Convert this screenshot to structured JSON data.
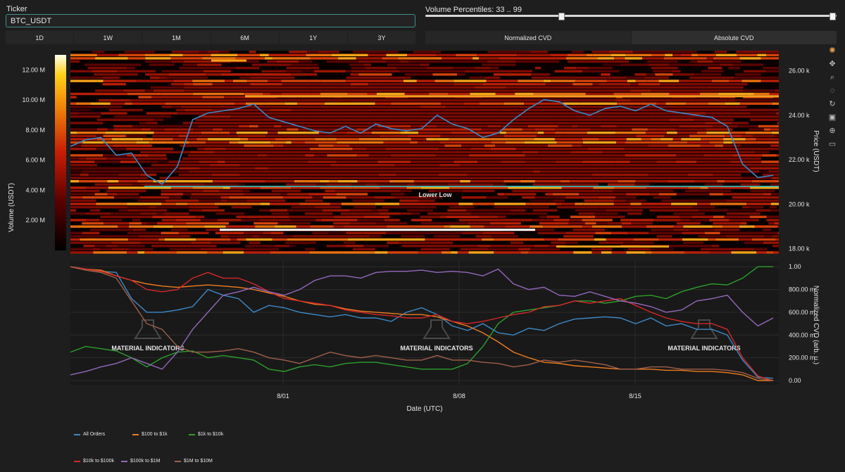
{
  "ticker": {
    "label": "Ticker",
    "value": "BTC_USDT"
  },
  "time_ranges": [
    "1D",
    "1W",
    "1M",
    "6M",
    "1Y",
    "3Y"
  ],
  "volume_percentiles": {
    "label": "Volume Percentiles: 33 .. 99",
    "low": 33,
    "high": 99,
    "min": 0,
    "max": 100
  },
  "cvd_modes": {
    "normalized": "Normalized CVD",
    "absolute": "Absolute CVD"
  },
  "toolbar_icons": [
    "color-wheel-icon",
    "pan-icon",
    "zoom-icon",
    "lasso-icon",
    "rotate-icon",
    "save-icon",
    "crosshair-icon",
    "comment-icon"
  ],
  "watermark": "MATERIAL INDICATORS",
  "chart_data": [
    {
      "type": "heatmap",
      "colorbar": {
        "title": "Volume (USDT)",
        "ticks": [
          "2.00 M",
          "4.00 M",
          "6.00 M",
          "8.00 M",
          "10.00 M",
          "12.00 M"
        ],
        "range": [
          0,
          13000000
        ]
      },
      "ylabel": "Price (USDT)",
      "yticks": [
        "18.00 k",
        "20.00 k",
        "22.00 k",
        "24.00 k",
        "26.00 k"
      ],
      "ylim": [
        17800,
        26900
      ],
      "annotation": {
        "text": "Lower Low",
        "price": 20800,
        "color": "#2fd4d4"
      },
      "series": [
        {
          "name": "Price",
          "color": "#3c89c8",
          "values": [
            22600,
            22900,
            23000,
            22200,
            22300,
            21300,
            20900,
            21700,
            23800,
            24100,
            24200,
            24300,
            24500,
            23900,
            23700,
            23500,
            23300,
            23200,
            23500,
            23200,
            23600,
            23400,
            23300,
            23400,
            24000,
            23600,
            23400,
            23000,
            23200,
            23800,
            24300,
            24700,
            24600,
            24200,
            24000,
            24300,
            24400,
            24200,
            24500,
            24200,
            24100,
            24000,
            23900,
            23500,
            21800,
            21200,
            21300
          ]
        }
      ]
    },
    {
      "type": "line",
      "ylabel": "Normalized CVD (arb. u.)",
      "yticks": [
        "0.00",
        "200.00 m",
        "400.00 m",
        "600.00 m",
        "800.00 m",
        "1.00"
      ],
      "ylim": [
        0,
        1.02
      ],
      "xlabel": "Date (UTC)",
      "xticks": [
        "8/01",
        "8/08",
        "8/15"
      ],
      "series": [
        {
          "name": "All Orders",
          "color": "#3c89c8",
          "values": [
            1.0,
            0.98,
            0.96,
            0.95,
            0.72,
            0.6,
            0.6,
            0.62,
            0.65,
            0.8,
            0.75,
            0.72,
            0.6,
            0.66,
            0.64,
            0.6,
            0.58,
            0.56,
            0.58,
            0.55,
            0.55,
            0.52,
            0.6,
            0.64,
            0.58,
            0.48,
            0.44,
            0.5,
            0.42,
            0.4,
            0.46,
            0.44,
            0.5,
            0.54,
            0.55,
            0.56,
            0.55,
            0.5,
            0.55,
            0.48,
            0.5,
            0.45,
            0.45,
            0.4,
            0.18,
            0.03,
            0.02
          ]
        },
        {
          "name": "$100 to $1k",
          "color": "#ef7d1e",
          "values": [
            1.0,
            0.98,
            0.97,
            0.92,
            0.88,
            0.85,
            0.83,
            0.82,
            0.83,
            0.84,
            0.83,
            0.82,
            0.8,
            0.77,
            0.74,
            0.7,
            0.67,
            0.66,
            0.63,
            0.61,
            0.6,
            0.59,
            0.58,
            0.58,
            0.56,
            0.52,
            0.48,
            0.42,
            0.34,
            0.25,
            0.2,
            0.16,
            0.15,
            0.13,
            0.12,
            0.11,
            0.1,
            0.1,
            0.1,
            0.09,
            0.09,
            0.08,
            0.08,
            0.07,
            0.05,
            0.0,
            0.0
          ]
        },
        {
          "name": "$1k to $10k",
          "color": "#2ca02c",
          "values": [
            0.25,
            0.3,
            0.28,
            0.26,
            0.2,
            0.12,
            0.2,
            0.25,
            0.26,
            0.2,
            0.22,
            0.2,
            0.18,
            0.1,
            0.08,
            0.12,
            0.14,
            0.12,
            0.15,
            0.16,
            0.16,
            0.14,
            0.12,
            0.1,
            0.1,
            0.1,
            0.15,
            0.3,
            0.5,
            0.6,
            0.62,
            0.64,
            0.66,
            0.7,
            0.7,
            0.68,
            0.7,
            0.74,
            0.75,
            0.72,
            0.78,
            0.82,
            0.85,
            0.84,
            0.9,
            1.0,
            1.0
          ]
        },
        {
          "name": "$10k to $100k",
          "color": "#d62728",
          "values": [
            1.0,
            0.98,
            0.96,
            0.92,
            0.88,
            0.8,
            0.78,
            0.8,
            0.9,
            0.95,
            0.9,
            0.9,
            0.85,
            0.78,
            0.72,
            0.7,
            0.68,
            0.66,
            0.62,
            0.6,
            0.58,
            0.57,
            0.55,
            0.55,
            0.58,
            0.52,
            0.5,
            0.52,
            0.55,
            0.58,
            0.6,
            0.65,
            0.66,
            0.7,
            0.68,
            0.7,
            0.72,
            0.66,
            0.6,
            0.55,
            0.52,
            0.5,
            0.5,
            0.45,
            0.2,
            0.04,
            0.0
          ]
        },
        {
          "name": "$100k to $1M",
          "color": "#9467bd",
          "values": [
            0.05,
            0.08,
            0.12,
            0.15,
            0.2,
            0.15,
            0.1,
            0.25,
            0.45,
            0.6,
            0.75,
            0.78,
            0.82,
            0.78,
            0.75,
            0.8,
            0.88,
            0.92,
            0.92,
            0.9,
            0.95,
            0.96,
            0.96,
            0.97,
            0.95,
            0.96,
            0.95,
            0.92,
            0.98,
            0.85,
            0.8,
            0.82,
            0.75,
            0.74,
            0.78,
            0.74,
            0.7,
            0.68,
            0.65,
            0.6,
            0.62,
            0.7,
            0.72,
            0.75,
            0.6,
            0.48,
            0.55
          ]
        },
        {
          "name": "$1M to $10M",
          "color": "#a0604a",
          "values": [
            1.0,
            0.97,
            0.95,
            0.9,
            0.7,
            0.5,
            0.45,
            0.3,
            0.25,
            0.25,
            0.26,
            0.28,
            0.25,
            0.2,
            0.18,
            0.15,
            0.2,
            0.25,
            0.22,
            0.2,
            0.22,
            0.2,
            0.18,
            0.18,
            0.22,
            0.18,
            0.18,
            0.16,
            0.15,
            0.12,
            0.14,
            0.18,
            0.16,
            0.18,
            0.16,
            0.14,
            0.1,
            0.1,
            0.12,
            0.12,
            0.1,
            0.1,
            0.1,
            0.09,
            0.07,
            0.02,
            0.0
          ]
        }
      ]
    }
  ]
}
